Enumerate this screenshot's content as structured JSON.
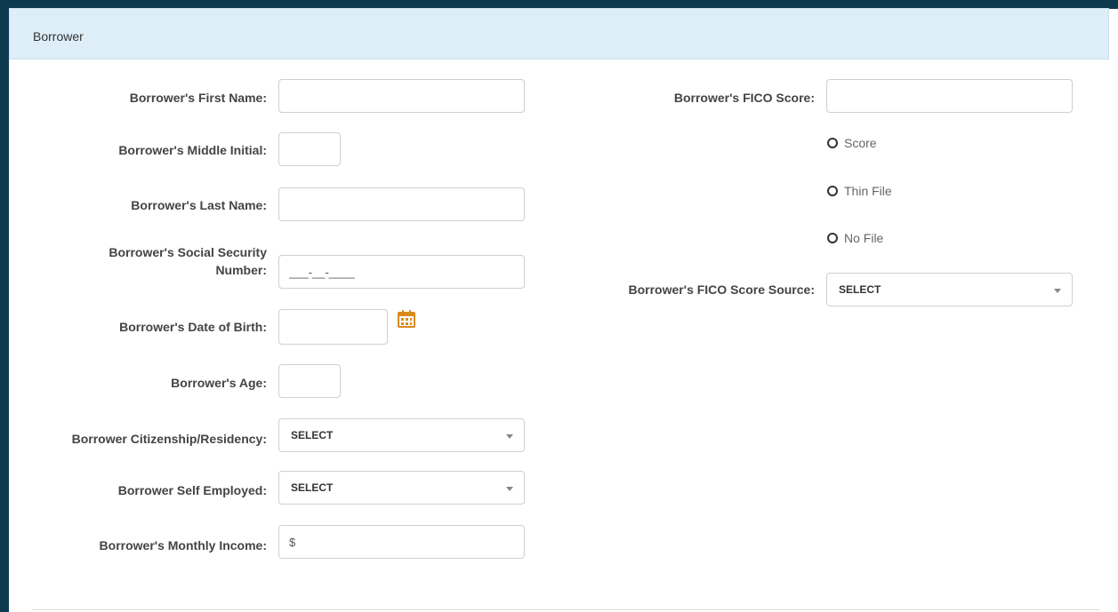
{
  "panel": {
    "title": "Borrower"
  },
  "left": {
    "first_name": {
      "label": "Borrower's First Name:",
      "value": ""
    },
    "middle_initial": {
      "label": "Borrower's Middle Initial:",
      "value": ""
    },
    "last_name": {
      "label": "Borrower's Last Name:",
      "value": ""
    },
    "ssn": {
      "label_line1": "Borrower's Social Security",
      "label_line2": "Number:",
      "mask": "___-__-____"
    },
    "dob": {
      "label": "Borrower's Date of Birth:",
      "value": ""
    },
    "age": {
      "label": "Borrower's Age:",
      "value": ""
    },
    "citizenship": {
      "label": "Borrower Citizenship/Residency:",
      "selected": "SELECT"
    },
    "self_employed": {
      "label": "Borrower Self Employed:",
      "selected": "SELECT"
    },
    "monthly_income": {
      "label": "Borrower's Monthly Income:",
      "value": "$"
    }
  },
  "right": {
    "fico_score": {
      "label": "Borrower's FICO Score:",
      "value": ""
    },
    "radios": [
      "Score",
      "Thin File",
      "No File"
    ],
    "fico_source": {
      "label": "Borrower's FICO Score Source:",
      "selected": "SELECT"
    }
  },
  "icons": {
    "calendar": "calendar-icon",
    "calendar_color": "#d98a1c"
  },
  "colors": {
    "frame": "#0e3a4f",
    "header_bg": "#ddeef8"
  }
}
